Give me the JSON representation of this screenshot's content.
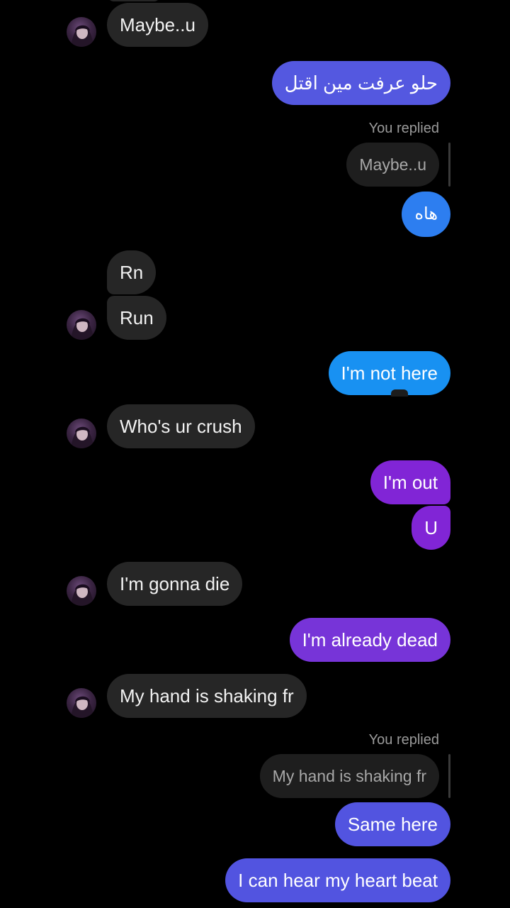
{
  "colors": {
    "background": "#000000",
    "incoming_bubble": "#262626",
    "outgoing_indigo": "#5458e0",
    "outgoing_blue": "#2d7ef0",
    "outgoing_sky": "#1891f2",
    "outgoing_purple": "#8125d6",
    "outgoing_violet": "#7734d8"
  },
  "avatar_icon": "profile-photo-icon",
  "messages": [
    {
      "id": "m1",
      "direction": "incoming",
      "text": "Maybe..u",
      "avatar": true
    },
    {
      "id": "m2",
      "direction": "outgoing",
      "text": "حلو عرفت مين اقتل"
    },
    {
      "id": "m3",
      "direction": "outgoing",
      "text": "هاه",
      "reply": {
        "label": "You replied",
        "quoted_text": "Maybe..u"
      }
    },
    {
      "id": "m4",
      "direction": "incoming",
      "text": "Rn"
    },
    {
      "id": "m5",
      "direction": "incoming",
      "text": "Run",
      "avatar": true
    },
    {
      "id": "m6",
      "direction": "outgoing",
      "text": "I'm not here"
    },
    {
      "id": "m7",
      "direction": "incoming",
      "text": "Who's ur crush",
      "avatar": true
    },
    {
      "id": "m8",
      "direction": "outgoing",
      "text": "I'm out"
    },
    {
      "id": "m9",
      "direction": "outgoing",
      "text": "U"
    },
    {
      "id": "m10",
      "direction": "incoming",
      "text": "I'm gonna die",
      "avatar": true
    },
    {
      "id": "m11",
      "direction": "outgoing",
      "text": "I'm already dead"
    },
    {
      "id": "m12",
      "direction": "incoming",
      "text": "My hand is shaking fr",
      "avatar": true
    },
    {
      "id": "m13",
      "direction": "outgoing",
      "text": "Same here",
      "reply": {
        "label": "You replied",
        "quoted_text": "My hand is shaking fr"
      }
    },
    {
      "id": "m14",
      "direction": "outgoing",
      "text": "I can hear my heart beat"
    }
  ]
}
